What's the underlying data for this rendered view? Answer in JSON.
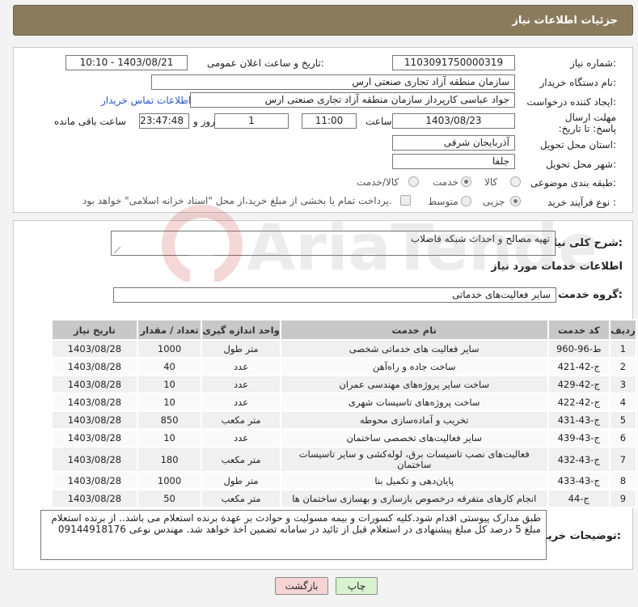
{
  "header": {
    "title": "جزئیات اطلاعات نیاز"
  },
  "form": {
    "need_number_label": "شماره نیاز:",
    "need_number": "1103091750000319",
    "announce_label": "تاریخ و ساعت اعلان عمومی:",
    "announce_value": "1403/08/21 - 10:10",
    "buyer_org_label": "نام دستگاه خریدار:",
    "buyer_org": "سازمان منطقه آزاد تجاری صنعتی ارس",
    "creator_label": "ایجاد کننده درخواست:",
    "creator": "جواد عباسی کارپرداز سازمان منطقه آزاد تجاری صنعتی ارس",
    "contact_link": "اطلاعات تماس خریدار",
    "deadline_label": "مهلت ارسال پاسخ: تا تاریخ:",
    "deadline_date": "1403/08/23",
    "time_label": "ساعت",
    "deadline_time": "11:00",
    "days_value": "1",
    "days_label": "روز و",
    "remaining_value": "23:47:48",
    "remaining_label": "ساعت باقی مانده",
    "province_label": "استان محل تحویل:",
    "province": "آذربایجان شرقی",
    "city_label": "شهر محل تحویل:",
    "city": "جلفا",
    "category_label": "طبقه بندی موضوعی:",
    "category_options": [
      "کالا",
      "خدمت",
      "کالا/خدمت"
    ],
    "category_selected": "خدمت",
    "process_label": "نوع فرآیند خرید :",
    "process_options": [
      "جزیی",
      "متوسط"
    ],
    "process_selected": "جزیی",
    "payment_note": "پرداخت تمام یا بخشی از مبلغ خرید،از محل \"اسناد خزانه اسلامی\" خواهد بود."
  },
  "details": {
    "summary_label": "شرح کلی نیاز:",
    "summary": "تهیه مصالح و احداث شبکه فاضلاب",
    "services_title": "اطلاعات خدمات مورد نیاز",
    "group_label": "گروه خدمت:",
    "group_value": "سایر فعالیت‌های خدماتی",
    "table_headers": [
      "ردیف",
      "کد خدمت",
      "نام خدمت",
      "واحد اندازه گیری",
      "تعداد / مقدار",
      "تاریخ نیاز"
    ],
    "rows": [
      [
        "1",
        "ط-96-960",
        "سایر فعالیت های خدماتی شخصی",
        "متر طول",
        "1000",
        "1403/08/28"
      ],
      [
        "2",
        "ج-42-421",
        "ساخت جاده و راه‌آهن",
        "عدد",
        "40",
        "1403/08/28"
      ],
      [
        "3",
        "ج-42-429",
        "ساخت سایر پروژه‌های مهندسی عمران",
        "عدد",
        "10",
        "1403/08/28"
      ],
      [
        "4",
        "ج-42-422",
        "ساخت پروژه‌های تاسیسات شهری",
        "عدد",
        "10",
        "1403/08/28"
      ],
      [
        "5",
        "ج-43-431",
        "تخریب و آماده‌سازی محوطه",
        "متر مکعب",
        "850",
        "1403/08/28"
      ],
      [
        "6",
        "ج-43-439",
        "سایر فعالیت‌های تخصصی ساختمان",
        "عدد",
        "10",
        "1403/08/28"
      ],
      [
        "7",
        "ج-43-432",
        "فعالیت‌های نصب تاسیسات برق، لوله‌کشی و سایر تاسیسات ساختمان",
        "متر مکعب",
        "180",
        "1403/08/28"
      ],
      [
        "8",
        "ج-43-433",
        "پایان‌دهی و تکمیل بنا",
        "متر طول",
        "1000",
        "1403/08/28"
      ],
      [
        "9",
        "ج-44",
        "انجام کارهای متفرقه درخصوص بازسازی و بهسازی ساختمان ها",
        "متر مکعب",
        "50",
        "1403/08/28"
      ]
    ],
    "notes_label": "توضیحات خریدار:",
    "notes": "طبق مدارک پیوستی اقدام شود.کلیه کسورات و بیمه مسولیت و حوادث بر عهدة برنده استعلام می باشد.. از برنده استعلام مبلغ 5 درصد کل مبلغ پیشنهادی در استعلام قبل از تائید در سامانه تضمین اخذ خواهد شد. مهندس نوعی 09144918176"
  },
  "buttons": {
    "print": "چاپ",
    "back": "بازگشت"
  },
  "colors": {
    "header_bg": "#8b7b5d",
    "back_btn_bg": "#f6d4d4",
    "print_btn_bg": "#d9f2d0",
    "link": "#2a56c6"
  }
}
